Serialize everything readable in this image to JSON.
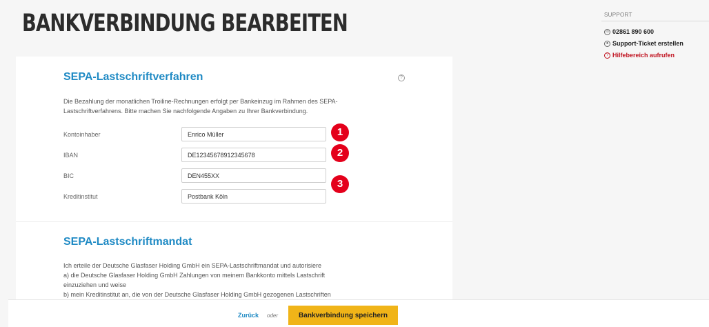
{
  "page": {
    "title": "BANKVERBINDUNG BEARBEITEN"
  },
  "sepa": {
    "title": "SEPA-Lastschriftverfahren",
    "intro": "Die Bezahlung der monatlichen Troiline-Rechnungen erfolgt per Bankeinzug im Rahmen des SEPA-Lastschriftverfahrens. Bitte machen Sie nachfolgende Angaben zu Ihrer Bankverbindung.",
    "fields": [
      {
        "label": "Kontoinhaber",
        "value": "Enrico Müller"
      },
      {
        "label": "IBAN",
        "value": "DE12345678912345678"
      },
      {
        "label": "BIC",
        "value": "DEN455XX"
      },
      {
        "label": "Kreditinstitut",
        "value": "Postbank Köln"
      }
    ],
    "help_icon": "?"
  },
  "annotations": [
    "1",
    "2",
    "3"
  ],
  "mandate": {
    "title": "SEPA-Lastschriftmandat",
    "lines": [
      "Ich erteile der Deutsche Glasfaser Holding GmbH ein SEPA-Lastschriftmandat und autorisiere",
      "a) die Deutsche Glasfaser Holding GmbH Zahlungen von meinem Bankkonto mittels Lastschrift",
      "einzuziehen und weise",
      "b) mein Kreditinstitut an, die von der Deutsche Glasfaser Holding GmbH gezogenen Lastschriften"
    ]
  },
  "support": {
    "heading": "SUPPORT",
    "phone": "02861 890 600",
    "ticket": "Support-Ticket erstellen",
    "help": "Hilfebereich aufrufen",
    "help_color": "#c0121f"
  },
  "footer": {
    "back": "Zurück",
    "or": "oder",
    "save": "Bankverbindung speichern"
  },
  "colors": {
    "accent": "#1f8ac4",
    "button": "#f0b418",
    "badge": "#e4001b"
  }
}
